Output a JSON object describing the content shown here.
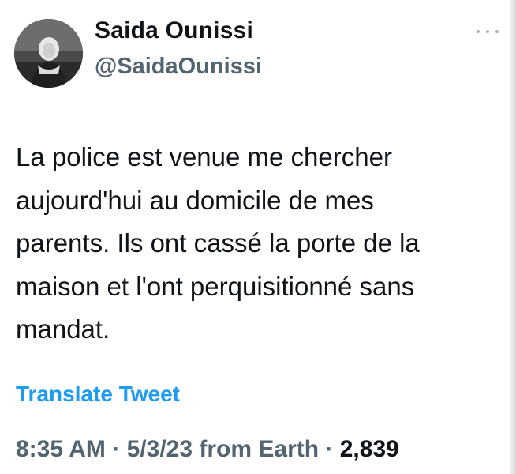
{
  "author": {
    "display_name": "Saida Ounissi",
    "handle": "@SaidaOunissi",
    "avatar_icon": "profile-photo"
  },
  "more_icon": "more-dots-icon",
  "tweet": {
    "text_lines": [
      "La police est venue me chercher",
      "aujourd'hui au domicile de mes",
      "parents. Ils ont cassé la porte de la",
      "maison et l'ont perquisitionné sans",
      "mandat."
    ],
    "translate_label": "Translate Tweet",
    "time": "8:35 AM",
    "date": "5/3/23",
    "source": "from Earth",
    "separator": "·",
    "views": "2,839"
  },
  "colors": {
    "text_primary": "#0f1419",
    "text_secondary": "#536471",
    "link": "#1d9bf0"
  }
}
